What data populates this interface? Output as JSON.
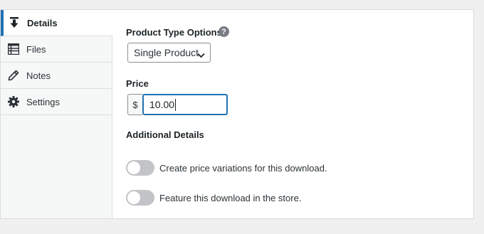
{
  "tabs": [
    {
      "label": "Details",
      "icon": "download-icon",
      "active": true
    },
    {
      "label": "Files",
      "icon": "list-icon"
    },
    {
      "label": "Notes",
      "icon": "pencil-icon"
    },
    {
      "label": "Settings",
      "icon": "gear-icon"
    }
  ],
  "product_type": {
    "label": "Product Type Options:",
    "help": "?",
    "selected": "Single Product"
  },
  "price": {
    "label": "Price",
    "currency": "$",
    "value": "10.00"
  },
  "additional": {
    "label": "Additional Details",
    "toggles": [
      {
        "label": "Create price variations for this download.",
        "on": false
      },
      {
        "label": "Feature this download in the store.",
        "on": false
      }
    ]
  },
  "colors": {
    "accent": "#2271b1",
    "toggle_off": "#c3c4c7",
    "sidebar_bg": "#f6f7f7"
  }
}
